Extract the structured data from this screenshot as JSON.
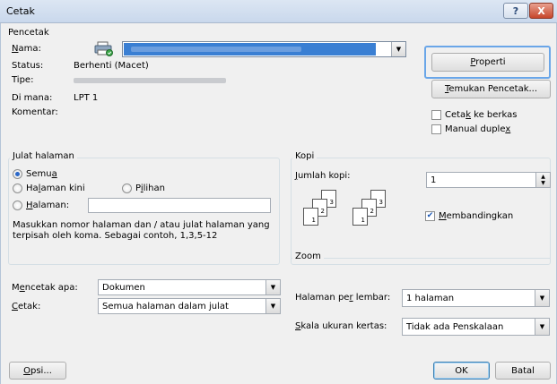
{
  "window": {
    "title": "Cetak",
    "help_label": "?",
    "close_label": "X"
  },
  "printer": {
    "group_label": "Pencetak",
    "name_label": "Nama:",
    "status_label": "Status:",
    "status_value": "Berhenti (Macet)",
    "type_label": "Tipe:",
    "where_label": "Di mana:",
    "where_value": "LPT 1",
    "comment_label": "Komentar:",
    "properties_button": "Properti",
    "find_printer_button": "Temukan Pencetak...",
    "print_to_file_label": "Cetak ke berkas",
    "print_to_file_checked": false,
    "manual_duplex_label": "Manual duplex",
    "manual_duplex_checked": false
  },
  "page_range": {
    "group_label": "Julat halaman",
    "all_label": "Semua",
    "current_page_label": "Halaman kini",
    "selection_label": "Pilihan",
    "pages_label": "Halaman:",
    "pages_value": "",
    "selected": "all",
    "hint": "Masukkan nomor halaman dan / atau julat halaman yang terpisah oleh koma. Sebagai contoh, 1,3,5-12"
  },
  "copies": {
    "group_label": "Kopi",
    "count_label": "Jumlah kopi:",
    "count_value": "1",
    "collate_label": "Membandingkan",
    "collate_checked": true,
    "collate_sheets_a": [
      "1",
      "2",
      "3"
    ],
    "collate_sheets_b": [
      "1",
      "2",
      "3"
    ]
  },
  "print_what": {
    "label": "Mencetak apa:",
    "value": "Dokumen"
  },
  "print": {
    "label": "Cetak:",
    "value": "Semua halaman dalam julat"
  },
  "zoom": {
    "group_label": "Zoom",
    "pages_per_sheet_label": "Halaman per lembar:",
    "pages_per_sheet_value": "1 halaman",
    "scale_label": "Skala ukuran kertas:",
    "scale_value": "Tidak ada Penskalaan"
  },
  "footer": {
    "options_button": "Opsi...",
    "ok_button": "OK",
    "cancel_button": "Batal"
  }
}
